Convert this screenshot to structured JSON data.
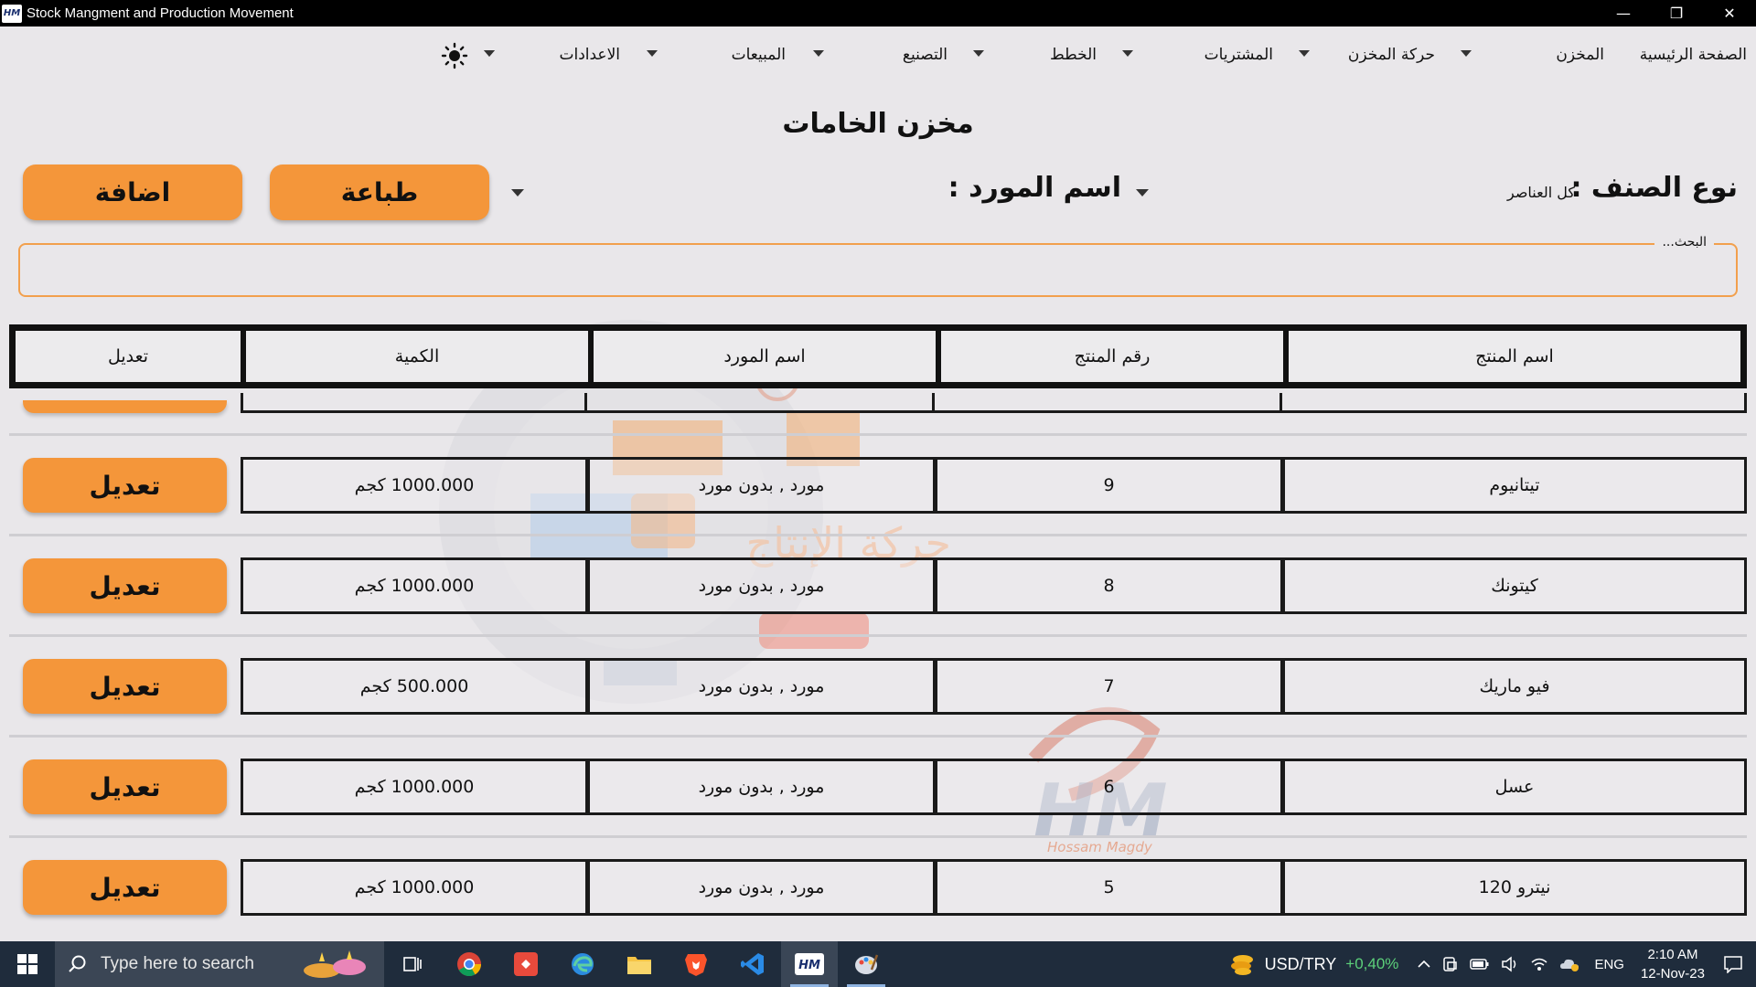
{
  "window": {
    "title": "Stock Mangment and Production Movement",
    "logo_text": "HM",
    "minimize": "—",
    "restore": "❐",
    "close": "✕"
  },
  "menu": {
    "items": [
      "الصفحة الرئيسية",
      "المخزن",
      "حركة المخزن",
      "المشتريات",
      "الخطط",
      "التصنيع",
      "المبيعات",
      "الاعدادات"
    ]
  },
  "page": {
    "title": "مخزن الخامات",
    "category_label": "نوع الصنف :",
    "category_value": "كل العناصر",
    "supplier_label": "اسم المورد :",
    "supplier_value": "",
    "print_button": "طباعة",
    "add_button": "اضافة",
    "search_label": "البحث...",
    "search_value": ""
  },
  "table": {
    "headers": {
      "product_name": "اسم المنتج",
      "product_number": "رقم المنتج",
      "supplier_name": "اسم المورد",
      "quantity": "الكمية",
      "edit": "تعديل"
    },
    "rows": [
      {
        "name": "تيتانيوم",
        "number": "9",
        "supplier": "مورد , بدون مورد",
        "quantity": "1000.000 كجم",
        "edit": "تعديل"
      },
      {
        "name": "كيتونك",
        "number": "8",
        "supplier": "مورد , بدون مورد",
        "quantity": "1000.000 كجم",
        "edit": "تعديل"
      },
      {
        "name": "فيو ماريك",
        "number": "7",
        "supplier": "مورد , بدون مورد",
        "quantity": "500.000 كجم",
        "edit": "تعديل"
      },
      {
        "name": "عسل",
        "number": "6",
        "supplier": "مورد , بدون مورد",
        "quantity": "1000.000 كجم",
        "edit": "تعديل"
      },
      {
        "name": "نيترو 120",
        "number": "5",
        "supplier": "مورد , بدون مورد",
        "quantity": "1000.000 كجم",
        "edit": "تعديل"
      }
    ]
  },
  "watermark": {
    "caption": "Hossam Magdy",
    "logo_text": "HM"
  },
  "taskbar": {
    "search_placeholder": "Type here to search",
    "currency": "USD/TRY",
    "currency_change": "+0,40%",
    "language": "ENG",
    "time": "2:10 AM",
    "date": "12-Nov-23"
  },
  "colors": {
    "accent": "#f4963a",
    "background": "#e9e7ea",
    "taskbar": "#1f2c3c"
  }
}
